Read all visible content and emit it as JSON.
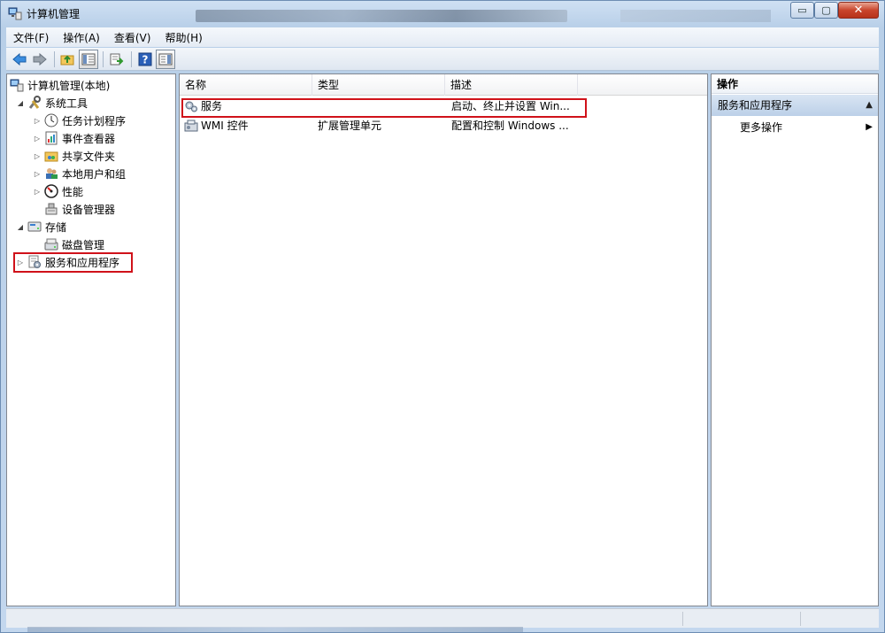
{
  "window": {
    "title": "计算机管理",
    "controls": {
      "minimize": "▭",
      "maximize": "▢",
      "close": "✕"
    }
  },
  "menu": {
    "items": [
      "文件(F)",
      "操作(A)",
      "查看(V)",
      "帮助(H)"
    ]
  },
  "toolbar": {
    "buttons": [
      "back-icon",
      "forward-icon",
      "up-folder-icon",
      "show-hide-tree-icon",
      "export-list-icon",
      "help-icon",
      "show-hide-action-pane-icon"
    ]
  },
  "tree": {
    "root": "计算机管理(本地)",
    "system_tools": "系统工具",
    "task_scheduler": "任务计划程序",
    "event_viewer": "事件查看器",
    "shared_folders": "共享文件夹",
    "local_users": "本地用户和组",
    "performance": "性能",
    "device_manager": "设备管理器",
    "storage": "存储",
    "disk_management": "磁盘管理",
    "services_apps": "服务和应用程序"
  },
  "list": {
    "columns": [
      "名称",
      "类型",
      "描述"
    ],
    "rows": [
      {
        "name": "服务",
        "type": "",
        "desc": "启动、终止并设置 Win..."
      },
      {
        "name": "WMI 控件",
        "type": "扩展管理单元",
        "desc": "配置和控制 Windows ..."
      }
    ]
  },
  "actions": {
    "header": "操作",
    "section": "服务和应用程序",
    "more": "更多操作"
  },
  "colors": {
    "highlight_box": "#d0121a",
    "titlebar": "#cfe0f3",
    "close_button": "#c9452c"
  }
}
